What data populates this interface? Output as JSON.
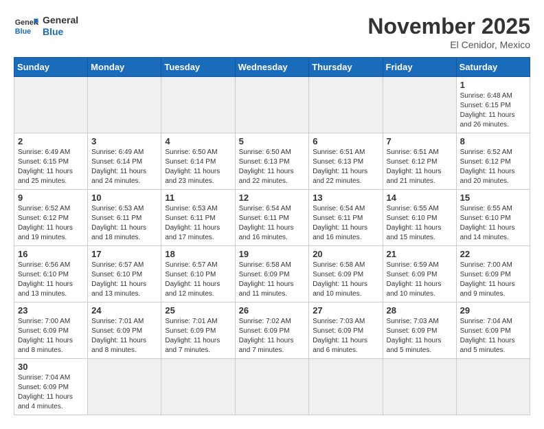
{
  "header": {
    "logo_general": "General",
    "logo_blue": "Blue",
    "month_title": "November 2025",
    "subtitle": "El Cenidor, Mexico"
  },
  "weekdays": [
    "Sunday",
    "Monday",
    "Tuesday",
    "Wednesday",
    "Thursday",
    "Friday",
    "Saturday"
  ],
  "weeks": [
    [
      {
        "day": "",
        "empty": true
      },
      {
        "day": "",
        "empty": true
      },
      {
        "day": "",
        "empty": true
      },
      {
        "day": "",
        "empty": true
      },
      {
        "day": "",
        "empty": true
      },
      {
        "day": "",
        "empty": true
      },
      {
        "day": "1",
        "sunrise": "Sunrise: 6:48 AM",
        "sunset": "Sunset: 6:15 PM",
        "daylight": "Daylight: 11 hours and 26 minutes."
      }
    ],
    [
      {
        "day": "2",
        "sunrise": "Sunrise: 6:49 AM",
        "sunset": "Sunset: 6:15 PM",
        "daylight": "Daylight: 11 hours and 25 minutes."
      },
      {
        "day": "3",
        "sunrise": "Sunrise: 6:49 AM",
        "sunset": "Sunset: 6:14 PM",
        "daylight": "Daylight: 11 hours and 24 minutes."
      },
      {
        "day": "4",
        "sunrise": "Sunrise: 6:50 AM",
        "sunset": "Sunset: 6:14 PM",
        "daylight": "Daylight: 11 hours and 23 minutes."
      },
      {
        "day": "5",
        "sunrise": "Sunrise: 6:50 AM",
        "sunset": "Sunset: 6:13 PM",
        "daylight": "Daylight: 11 hours and 22 minutes."
      },
      {
        "day": "6",
        "sunrise": "Sunrise: 6:51 AM",
        "sunset": "Sunset: 6:13 PM",
        "daylight": "Daylight: 11 hours and 22 minutes."
      },
      {
        "day": "7",
        "sunrise": "Sunrise: 6:51 AM",
        "sunset": "Sunset: 6:12 PM",
        "daylight": "Daylight: 11 hours and 21 minutes."
      },
      {
        "day": "8",
        "sunrise": "Sunrise: 6:52 AM",
        "sunset": "Sunset: 6:12 PM",
        "daylight": "Daylight: 11 hours and 20 minutes."
      }
    ],
    [
      {
        "day": "9",
        "sunrise": "Sunrise: 6:52 AM",
        "sunset": "Sunset: 6:12 PM",
        "daylight": "Daylight: 11 hours and 19 minutes."
      },
      {
        "day": "10",
        "sunrise": "Sunrise: 6:53 AM",
        "sunset": "Sunset: 6:11 PM",
        "daylight": "Daylight: 11 hours and 18 minutes."
      },
      {
        "day": "11",
        "sunrise": "Sunrise: 6:53 AM",
        "sunset": "Sunset: 6:11 PM",
        "daylight": "Daylight: 11 hours and 17 minutes."
      },
      {
        "day": "12",
        "sunrise": "Sunrise: 6:54 AM",
        "sunset": "Sunset: 6:11 PM",
        "daylight": "Daylight: 11 hours and 16 minutes."
      },
      {
        "day": "13",
        "sunrise": "Sunrise: 6:54 AM",
        "sunset": "Sunset: 6:11 PM",
        "daylight": "Daylight: 11 hours and 16 minutes."
      },
      {
        "day": "14",
        "sunrise": "Sunrise: 6:55 AM",
        "sunset": "Sunset: 6:10 PM",
        "daylight": "Daylight: 11 hours and 15 minutes."
      },
      {
        "day": "15",
        "sunrise": "Sunrise: 6:55 AM",
        "sunset": "Sunset: 6:10 PM",
        "daylight": "Daylight: 11 hours and 14 minutes."
      }
    ],
    [
      {
        "day": "16",
        "sunrise": "Sunrise: 6:56 AM",
        "sunset": "Sunset: 6:10 PM",
        "daylight": "Daylight: 11 hours and 13 minutes."
      },
      {
        "day": "17",
        "sunrise": "Sunrise: 6:57 AM",
        "sunset": "Sunset: 6:10 PM",
        "daylight": "Daylight: 11 hours and 13 minutes."
      },
      {
        "day": "18",
        "sunrise": "Sunrise: 6:57 AM",
        "sunset": "Sunset: 6:10 PM",
        "daylight": "Daylight: 11 hours and 12 minutes."
      },
      {
        "day": "19",
        "sunrise": "Sunrise: 6:58 AM",
        "sunset": "Sunset: 6:09 PM",
        "daylight": "Daylight: 11 hours and 11 minutes."
      },
      {
        "day": "20",
        "sunrise": "Sunrise: 6:58 AM",
        "sunset": "Sunset: 6:09 PM",
        "daylight": "Daylight: 11 hours and 10 minutes."
      },
      {
        "day": "21",
        "sunrise": "Sunrise: 6:59 AM",
        "sunset": "Sunset: 6:09 PM",
        "daylight": "Daylight: 11 hours and 10 minutes."
      },
      {
        "day": "22",
        "sunrise": "Sunrise: 7:00 AM",
        "sunset": "Sunset: 6:09 PM",
        "daylight": "Daylight: 11 hours and 9 minutes."
      }
    ],
    [
      {
        "day": "23",
        "sunrise": "Sunrise: 7:00 AM",
        "sunset": "Sunset: 6:09 PM",
        "daylight": "Daylight: 11 hours and 8 minutes."
      },
      {
        "day": "24",
        "sunrise": "Sunrise: 7:01 AM",
        "sunset": "Sunset: 6:09 PM",
        "daylight": "Daylight: 11 hours and 8 minutes."
      },
      {
        "day": "25",
        "sunrise": "Sunrise: 7:01 AM",
        "sunset": "Sunset: 6:09 PM",
        "daylight": "Daylight: 11 hours and 7 minutes."
      },
      {
        "day": "26",
        "sunrise": "Sunrise: 7:02 AM",
        "sunset": "Sunset: 6:09 PM",
        "daylight": "Daylight: 11 hours and 7 minutes."
      },
      {
        "day": "27",
        "sunrise": "Sunrise: 7:03 AM",
        "sunset": "Sunset: 6:09 PM",
        "daylight": "Daylight: 11 hours and 6 minutes."
      },
      {
        "day": "28",
        "sunrise": "Sunrise: 7:03 AM",
        "sunset": "Sunset: 6:09 PM",
        "daylight": "Daylight: 11 hours and 5 minutes."
      },
      {
        "day": "29",
        "sunrise": "Sunrise: 7:04 AM",
        "sunset": "Sunset: 6:09 PM",
        "daylight": "Daylight: 11 hours and 5 minutes."
      }
    ],
    [
      {
        "day": "30",
        "sunrise": "Sunrise: 7:04 AM",
        "sunset": "Sunset: 6:09 PM",
        "daylight": "Daylight: 11 hours and 4 minutes."
      },
      {
        "day": "",
        "empty": true
      },
      {
        "day": "",
        "empty": true
      },
      {
        "day": "",
        "empty": true
      },
      {
        "day": "",
        "empty": true
      },
      {
        "day": "",
        "empty": true
      },
      {
        "day": "",
        "empty": true
      }
    ]
  ]
}
